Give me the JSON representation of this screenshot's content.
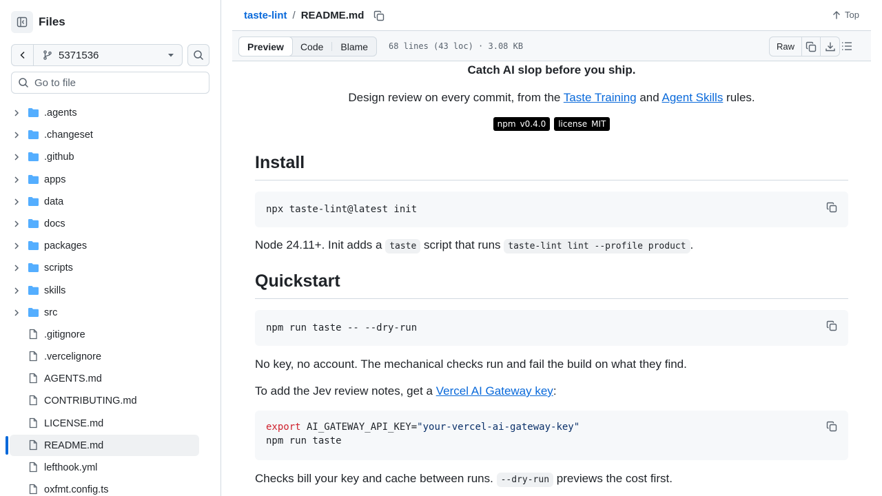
{
  "sidebar": {
    "title": "Files",
    "branch": "5371536",
    "goto_placeholder": "Go to file",
    "items": [
      {
        "label": ".agents",
        "type": "folder"
      },
      {
        "label": ".changeset",
        "type": "folder"
      },
      {
        "label": ".github",
        "type": "folder"
      },
      {
        "label": "apps",
        "type": "folder"
      },
      {
        "label": "data",
        "type": "folder"
      },
      {
        "label": "docs",
        "type": "folder"
      },
      {
        "label": "packages",
        "type": "folder"
      },
      {
        "label": "scripts",
        "type": "folder"
      },
      {
        "label": "skills",
        "type": "folder"
      },
      {
        "label": "src",
        "type": "folder"
      },
      {
        "label": ".gitignore",
        "type": "file"
      },
      {
        "label": ".vercelignore",
        "type": "file"
      },
      {
        "label": "AGENTS.md",
        "type": "file"
      },
      {
        "label": "CONTRIBUTING.md",
        "type": "file"
      },
      {
        "label": "LICENSE.md",
        "type": "file"
      },
      {
        "label": "README.md",
        "type": "file",
        "selected": true
      },
      {
        "label": "lefthook.yml",
        "type": "file"
      },
      {
        "label": "oxfmt.config.ts",
        "type": "file"
      }
    ]
  },
  "header": {
    "repo": "taste-lint",
    "separator": "/",
    "file": "README.md",
    "top_label": "Top"
  },
  "toolbar": {
    "tabs": [
      "Preview",
      "Code",
      "Blame"
    ],
    "active_tab": "Preview",
    "meta": "68 lines (43 loc) · 3.08 KB",
    "raw_label": "Raw"
  },
  "readme": {
    "tagline": "Catch AI slop before you ship.",
    "desc_before": "Design review on every commit, from the ",
    "link1": "Taste Training",
    "desc_mid": " and ",
    "link2": "Agent Skills",
    "desc_after": " rules.",
    "badge1_key": "npm",
    "badge1_val": "v0.4.0",
    "badge2_key": "license",
    "badge2_val": "MIT",
    "h_install": "Install",
    "code_install": "npx taste-lint@latest init",
    "node_p1": "Node 24.11+. Init adds a ",
    "node_code1": "taste",
    "node_p2": " script that runs ",
    "node_code2": "taste-lint lint --profile product",
    "node_p3": ".",
    "h_quick": "Quickstart",
    "code_quick": "npm run taste -- --dry-run",
    "nokey": "No key, no account. The mechanical checks run and fail the build on what they find.",
    "add_p1": "To add the Jev review notes, get a ",
    "add_link": "Vercel AI Gateway key",
    "add_p2": ":",
    "code_export_kw": "export",
    "code_export_var": " AI_GATEWAY_API_KEY=",
    "code_export_str": "\"your-vercel-ai-gateway-key\"",
    "code_export_line2": "npm run taste",
    "checks_p1": "Checks bill your key and cache between runs. ",
    "checks_code": "--dry-run",
    "checks_p2": " previews the cost first."
  },
  "colors": {
    "accent": "#0969da",
    "folder": "#54aeff",
    "border": "#d1d9e0"
  }
}
